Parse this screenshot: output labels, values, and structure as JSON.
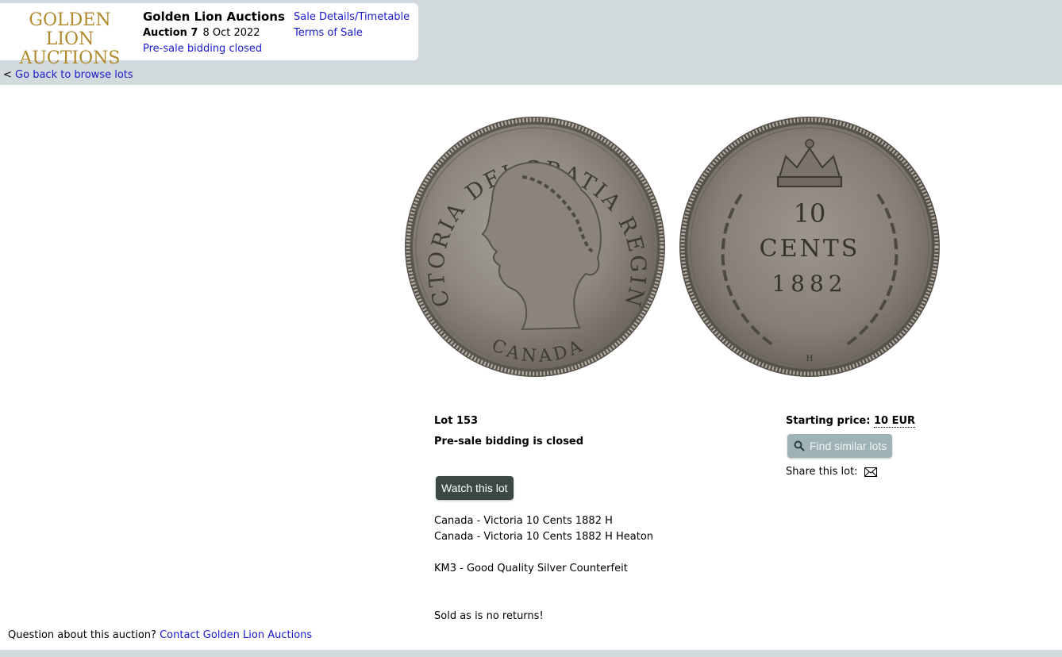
{
  "header": {
    "logo_line1": "GOLDEN LION",
    "logo_line2": "AUCTIONS",
    "title": "Golden Lion Auctions",
    "auction_label": "Auction 7",
    "auction_date": "8 Oct 2022",
    "status_link": "Pre-sale bidding closed",
    "links": [
      "Sale Details/Timetable",
      "Terms of Sale"
    ]
  },
  "nav": {
    "back_prefix": "<",
    "back_label": "Go back to browse lots"
  },
  "coins": {
    "obverse_legend": "VICTORIA DEI GRATIA REGINA.",
    "obverse_bottom": "CANADA",
    "reverse_value": "10",
    "reverse_unit": "CENTS",
    "reverse_year": "1882",
    "reverse_mint": "H"
  },
  "lot": {
    "number_label": "Lot 153",
    "closed_label": "Pre-sale bidding is closed",
    "watch_label": "Watch this lot",
    "description": [
      "Canada - Victoria 10 Cents 1882 H",
      "Canada - Victoria 10 Cents 1882 H Heaton",
      "",
      "KM3 - Good Quality Silver Counterfeit",
      "",
      "",
      "Sold as is no returns!"
    ]
  },
  "pricing": {
    "starting_label": "Starting price:",
    "starting_value": "10 EUR",
    "similar_label": "Find similar lots",
    "share_label": "Share this lot:"
  },
  "footer": {
    "question_label": "Question about this auction?",
    "contact_label": "Contact Golden Lion Auctions"
  },
  "colors": {
    "link": "#1a1acc",
    "logo_gold": "#b08a2c",
    "watch_btn": "#3c4844",
    "similar_btn": "#9fb3b6",
    "page_bg": "#d3dadd"
  }
}
